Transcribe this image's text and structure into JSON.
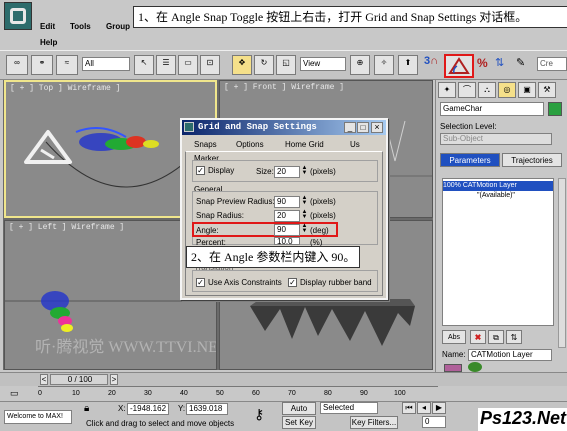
{
  "menu": {
    "items": [
      "Edit",
      "Tools",
      "Group",
      "Help"
    ]
  },
  "toolbar": {
    "selection_filter": "All",
    "ref_coord": "View",
    "named_sel_placeholder": "Cre"
  },
  "callouts": {
    "top": "1、在 Angle Snap Toggle 按钮上右击，打开 Grid and Snap Settings 对话框。",
    "mid": "2、在 Angle 参数栏内键入 90。"
  },
  "viewports": [
    {
      "label": "[ + ] Top ] Wireframe ]"
    },
    {
      "label": "[ + ] Front ] Wireframe ]"
    },
    {
      "label": "[ + ] Left ] Wireframe ]"
    },
    {
      "label": ""
    }
  ],
  "dialog": {
    "title": "Grid and Snap Settings",
    "tabs": [
      "Snaps",
      "Options",
      "Home Grid",
      "Us"
    ],
    "marker": {
      "group": "Marker",
      "display_label": "Display",
      "size_label": "Size:",
      "size_value": "20",
      "size_unit": "(pixels)"
    },
    "general": {
      "group": "General",
      "rows": [
        {
          "label": "Snap Preview Radius:",
          "value": "90",
          "unit": "(pixels)"
        },
        {
          "label": "Snap Radius:",
          "value": "20",
          "unit": "(pixels)"
        },
        {
          "label": "Angle:",
          "value": "90",
          "unit": "(deg)"
        },
        {
          "label": "Percent:",
          "value": "10.0",
          "unit": "(%)"
        }
      ]
    },
    "translation": {
      "group": "Translation",
      "axis_label": "Use Axis Constraints",
      "rubber_label": "Display rubber band"
    },
    "buttons": {
      "min": "_",
      "max": "□",
      "close": "×"
    }
  },
  "command_panel": {
    "object_name": "GameChar",
    "selection_level_label": "Selection Level:",
    "sub_object": "Sub-Object",
    "tabs": [
      "Parameters",
      "Trajectories"
    ],
    "layers": [
      "100% CATMotion Layer",
      "\"(Available)\""
    ],
    "name_label": "Name:",
    "name_value": "CATMotion Layer"
  },
  "timeline": {
    "frame": "0 / 100",
    "ticks": [
      "0",
      "10",
      "20",
      "30",
      "40",
      "50",
      "60",
      "70",
      "80",
      "90",
      "100"
    ]
  },
  "status": {
    "maxscript": "Welcome to MAX!",
    "prompt": "Click and drag to select and move objects",
    "x_label": "X:",
    "x_value": "-1948.162",
    "y_label": "Y:",
    "y_value": "1639.018",
    "auto_key": "Auto Key",
    "set_key": "Set Key",
    "selected": "Selected",
    "key_filters": "Key Filters...",
    "frame_value": "0"
  },
  "watermark": {
    "bottom": "Ps123.Net",
    "center": "听·腾视觉 WWW.TTVI.NET"
  },
  "colors": {
    "callout_red": "#e01818",
    "accent_blue": "#2050c0",
    "dialog_title": "#0a246a"
  }
}
